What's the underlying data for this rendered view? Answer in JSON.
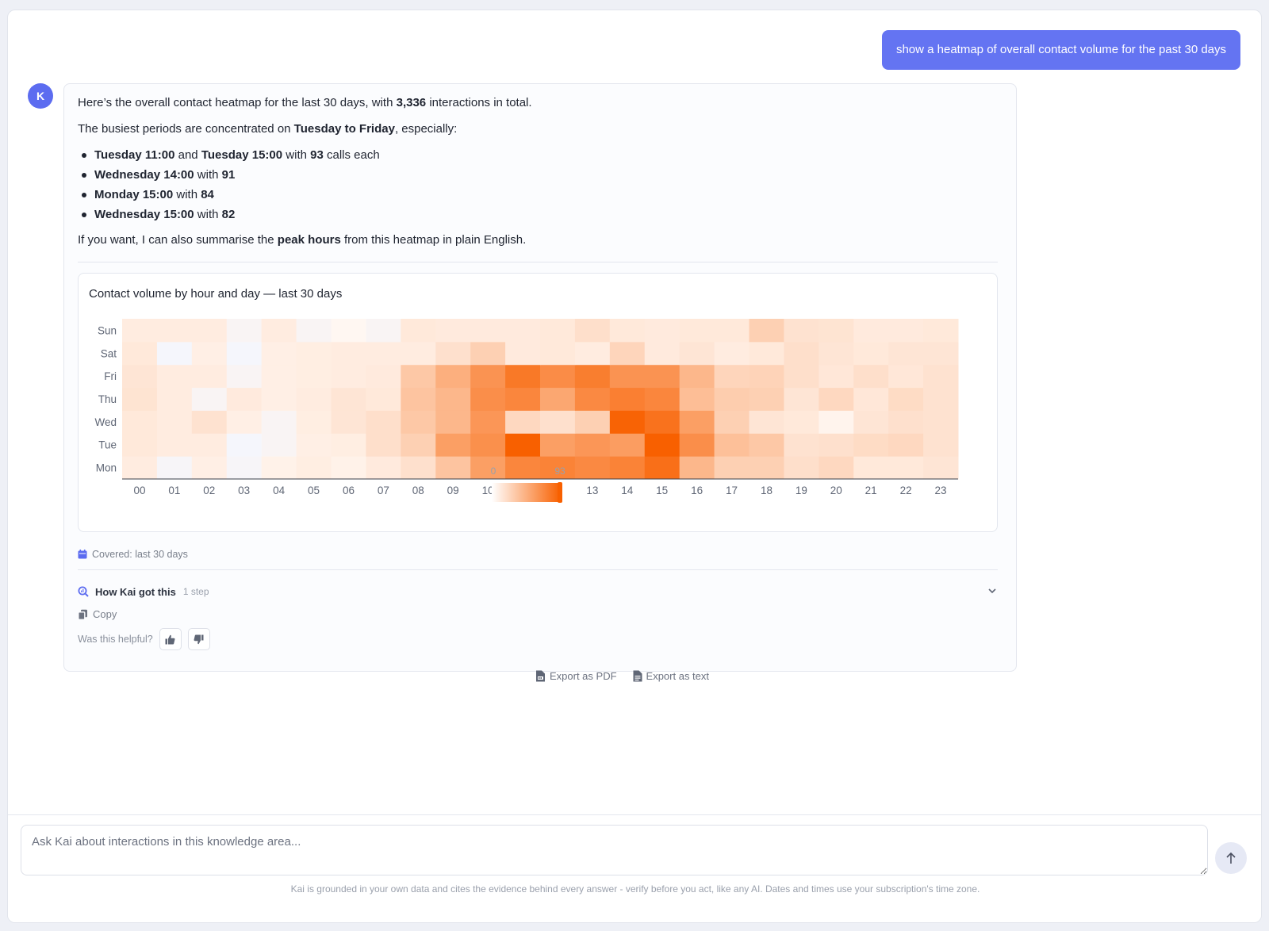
{
  "user_message": "show a heatmap of overall contact volume for the past 30 days",
  "assistant": {
    "avatar_initial": "K",
    "intro": {
      "before": "Here’s the overall contact heatmap for the last 30 days, with ",
      "total": "3,336",
      "after": " interactions in total."
    },
    "busiest": {
      "before": "The busiest periods are concentrated on ",
      "bold": "Tuesday to Friday",
      "after": ", especially:"
    },
    "peaks": [
      {
        "a": "Tuesday 11:00",
        "and": " and ",
        "b": "Tuesday 15:00",
        "with": " with ",
        "value": "93",
        "suffix": " calls each"
      },
      {
        "a": "Wednesday 14:00",
        "with": " with ",
        "value": "91"
      },
      {
        "a": "Monday 15:00",
        "with": " with ",
        "value": "84"
      },
      {
        "a": "Wednesday 15:00",
        "with": " with ",
        "value": "82"
      }
    ],
    "offer": {
      "before": "If you want, I can also summarise the ",
      "bold": "peak hours",
      "after": " from this heatmap in plain English."
    },
    "covered": "Covered: last 30 days",
    "how_title": "How Kai got this",
    "how_steps": "1 step",
    "copy_label": "Copy",
    "helpful_label": "Was this helpful?"
  },
  "export": {
    "pdf_label": "Export as PDF",
    "text_label": "Export as text"
  },
  "input": {
    "placeholder": "Ask Kai about interactions in this knowledge area..."
  },
  "disclaimer": "Kai is grounded in your own data and cites the evidence behind every answer - verify before you act, like any AI. Dates and times use your subscription's time zone.",
  "colors": {
    "accent": "#6474f2",
    "heat_high": "#f86000",
    "heat_low": "#f5f6fc"
  },
  "icons": [
    "calendar-icon",
    "search-chart-icon",
    "chevron-down-icon",
    "copy-icon",
    "thumbs-up-icon",
    "thumbs-down-icon",
    "pdf-file-icon",
    "text-file-icon",
    "arrow-up-icon"
  ],
  "chart_data": {
    "type": "heatmap",
    "title": "Contact volume by hour and day — last 30 days",
    "x": [
      "00",
      "01",
      "02",
      "03",
      "04",
      "05",
      "06",
      "07",
      "08",
      "09",
      "10",
      "11",
      "12",
      "13",
      "14",
      "15",
      "16",
      "17",
      "18",
      "19",
      "20",
      "21",
      "22",
      "23"
    ],
    "y": [
      "Mon",
      "Tue",
      "Wed",
      "Thu",
      "Fri",
      "Sat",
      "Sun"
    ],
    "values": [
      [
        8,
        1,
        6,
        1,
        5,
        7,
        5,
        9,
        15,
        32,
        55,
        70,
        72,
        68,
        72,
        84,
        40,
        25,
        25,
        16,
        20,
        10,
        10,
        12
      ],
      [
        10,
        8,
        8,
        0,
        2,
        6,
        7,
        16,
        25,
        55,
        64,
        93,
        55,
        60,
        56,
        93,
        65,
        35,
        30,
        14,
        15,
        18,
        20,
        14
      ],
      [
        10,
        8,
        14,
        6,
        2,
        7,
        12,
        16,
        30,
        40,
        60,
        20,
        15,
        25,
        91,
        82,
        55,
        25,
        12,
        10,
        4,
        12,
        15,
        14
      ],
      [
        13,
        8,
        2,
        9,
        6,
        8,
        12,
        10,
        32,
        40,
        65,
        70,
        50,
        68,
        74,
        70,
        36,
        27,
        25,
        12,
        20,
        11,
        18,
        14
      ],
      [
        12,
        8,
        8,
        2,
        6,
        7,
        8,
        9,
        30,
        45,
        62,
        78,
        66,
        75,
        62,
        62,
        40,
        22,
        23,
        16,
        11,
        16,
        11,
        14
      ],
      [
        10,
        0,
        6,
        0,
        6,
        7,
        8,
        8,
        8,
        15,
        25,
        9,
        10,
        8,
        22,
        9,
        12,
        8,
        10,
        16,
        12,
        10,
        12,
        12
      ],
      [
        8,
        8,
        8,
        2,
        8,
        2,
        3,
        2,
        10,
        9,
        9,
        9,
        10,
        16,
        10,
        9,
        10,
        10,
        25,
        14,
        13,
        9,
        9,
        10
      ]
    ],
    "zmin": 0,
    "zmax": 93,
    "legend_min": "0",
    "legend_max": "93"
  }
}
